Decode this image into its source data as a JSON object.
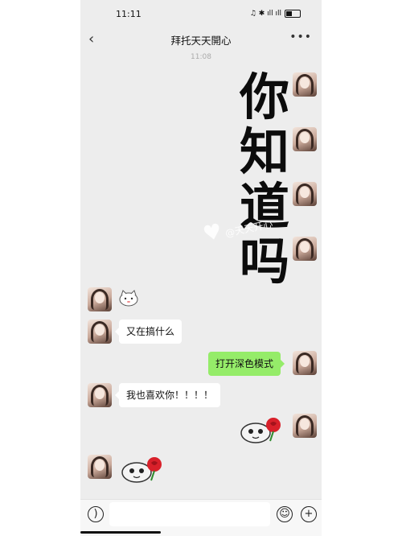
{
  "status_bar": {
    "time": "11:11",
    "indicators": "♫ ✱ ıll ıll"
  },
  "header": {
    "back_icon": "chevron-left-icon",
    "title": "拜托天天開心",
    "more_icon": "ellipsis-icon"
  },
  "chat": {
    "timestamp": "11:08",
    "big_text": [
      "你",
      "知",
      "道",
      "吗"
    ],
    "watermark": "@天天开心",
    "messages": {
      "reply_1": "又在搞什么",
      "sent_1": "打开深色模式",
      "reply_2": "我也喜欢你！！！！"
    },
    "sent_bubble_color": "#95ec69"
  },
  "input_bar": {
    "voice_icon": "voice-icon",
    "emoji_icon": "emoji-icon",
    "plus_icon": "plus-icon"
  }
}
